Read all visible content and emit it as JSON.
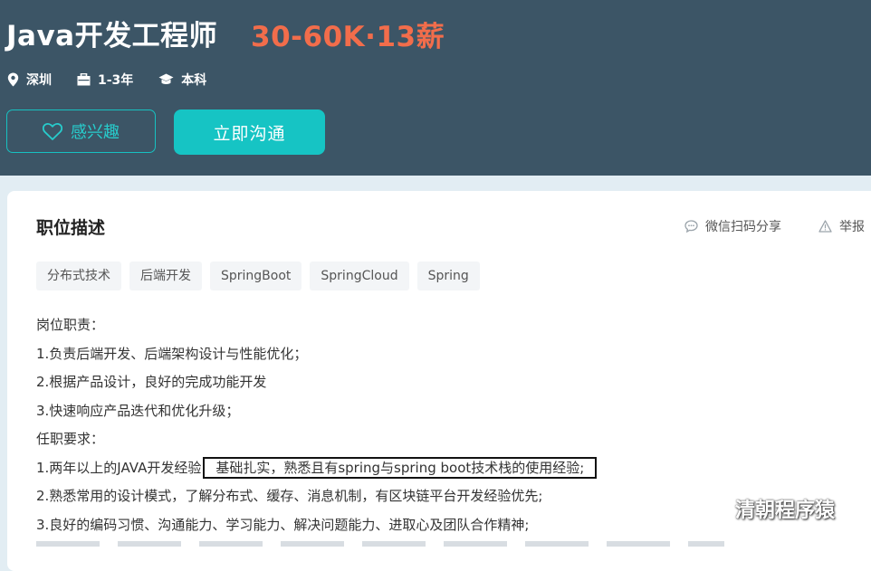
{
  "job": {
    "title": "Java开发工程师",
    "salary": "30-60K·13薪",
    "location": "深圳",
    "experience": "1-3年",
    "education": "本科"
  },
  "actions": {
    "interest_label": "感兴趣",
    "chat_label": "立即沟通"
  },
  "description": {
    "section_title": "职位描述",
    "share_label": "微信扫码分享",
    "report_label": "举报",
    "tags": [
      "分布式技术",
      "后端开发",
      "SpringBoot",
      "SpringCloud",
      "Spring"
    ],
    "responsibilities_heading": "岗位职责：",
    "responsibilities": [
      "1.负责后端开发、后端架构设计与性能优化；",
      "2.根据产品设计，良好的完成功能开发",
      "3.快速响应产品迭代和优化升级；"
    ],
    "requirements_heading": "任职要求：",
    "requirement_1_prefix": "1.两年以上的JAVA开发经验",
    "requirement_1_highlight": "基础扎实，熟悉且有spring与spring boot技术栈的使用经验;",
    "requirements": [
      "2.熟悉常用的设计模式，了解分布式、缓存、消息机制，有区块链平台开发经验优先;",
      "3.良好的编码习惯、沟通能力、学习能力、解决问题能力、进取心及团队合作精神;"
    ]
  },
  "watermark": {
    "text": "清朝程序猿"
  },
  "colors": {
    "header_bg": "#3c5566",
    "salary": "#f26d4b",
    "accent": "#16c4c4"
  }
}
